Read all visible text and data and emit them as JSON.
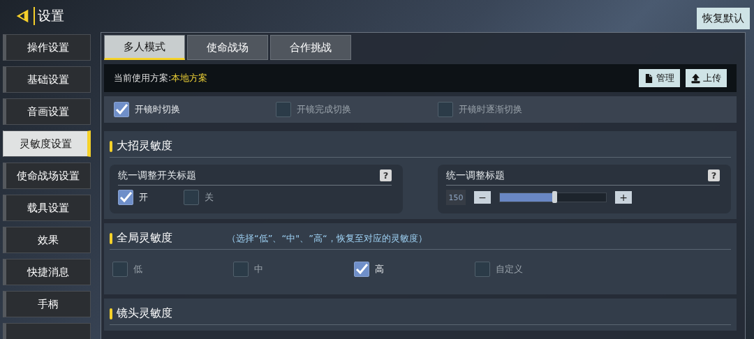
{
  "header": {
    "title": "设置",
    "reset_button": "恢复默认"
  },
  "sidebar": {
    "items": [
      {
        "label": "操作设置",
        "selected": false
      },
      {
        "label": "基础设置",
        "selected": false
      },
      {
        "label": "音画设置",
        "selected": false
      },
      {
        "label": "灵敏度设置",
        "selected": true
      },
      {
        "label": "使命战场设置",
        "selected": false
      },
      {
        "label": "载具设置",
        "selected": false
      },
      {
        "label": "效果",
        "selected": false
      },
      {
        "label": "快捷消息",
        "selected": false
      },
      {
        "label": "手柄",
        "selected": false
      }
    ]
  },
  "tabs": [
    {
      "label": "多人模式",
      "selected": true
    },
    {
      "label": "使命战场",
      "selected": false
    },
    {
      "label": "合作挑战",
      "selected": false
    }
  ],
  "scheme": {
    "label": "当前使用方案:",
    "value": "本地方案",
    "buttons": [
      {
        "label": "管理",
        "kind": "manage"
      },
      {
        "label": "上传",
        "kind": "upload"
      }
    ]
  },
  "scope_options": [
    {
      "label": "开镜时切换",
      "checked": true
    },
    {
      "label": "开镜完成切换",
      "checked": false
    },
    {
      "label": "开镜时逐渐切换",
      "checked": false
    }
  ],
  "sections": [
    {
      "kind": "ultimate",
      "title": "大招灵敏度",
      "toggle_card": {
        "title": "统一调整开关标题",
        "help": "?",
        "options": [
          {
            "label": "开",
            "checked": true
          },
          {
            "label": "关",
            "checked": false
          }
        ]
      },
      "slider_card": {
        "title": "统一调整标题",
        "help": "?",
        "value": "150",
        "minus": "−",
        "plus": "+",
        "level": 0.52
      }
    },
    {
      "kind": "global",
      "title": "全局灵敏度",
      "note": "（选择“低”、“中\"、”高“，恢复至对应的灵敏度）",
      "options": [
        {
          "label": "低",
          "checked": false
        },
        {
          "label": "中",
          "checked": false
        },
        {
          "label": "高",
          "checked": true
        },
        {
          "label": "自定义",
          "checked": false
        }
      ]
    },
    {
      "kind": "camera",
      "title": "镜头灵敏度"
    }
  ]
}
